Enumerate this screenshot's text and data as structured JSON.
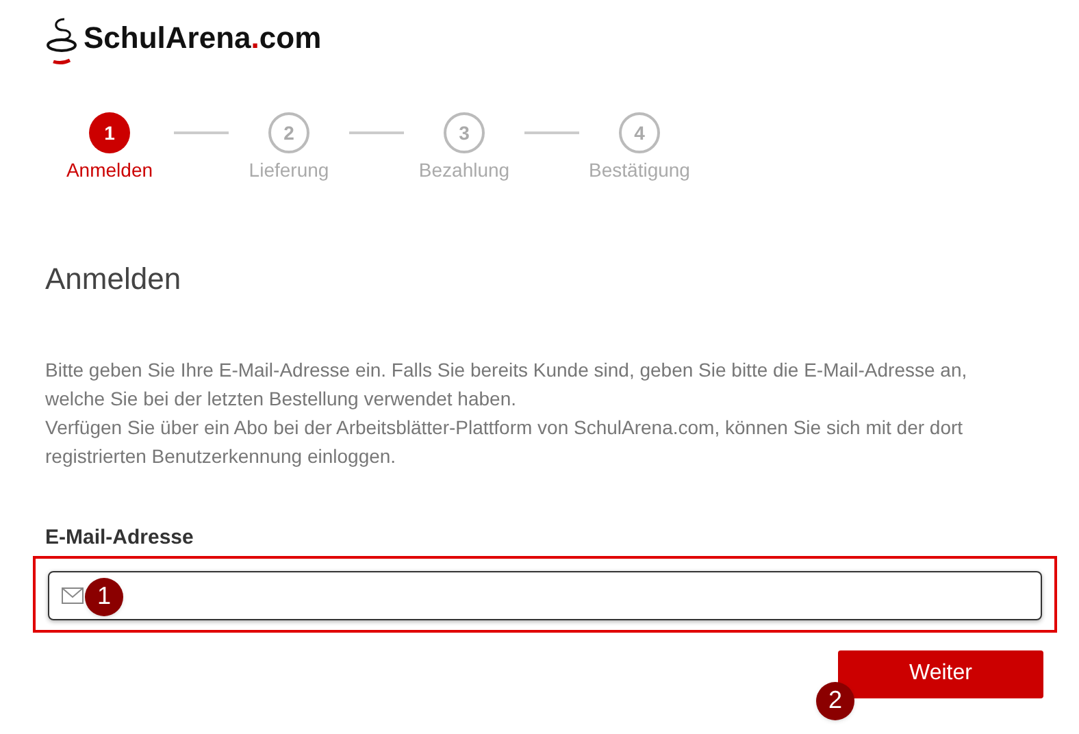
{
  "logo": {
    "name": "SchulArena",
    "dot": ".",
    "tld": "com"
  },
  "steps": [
    {
      "number": "1",
      "label": "Anmelden",
      "selected": true
    },
    {
      "number": "2",
      "label": "Lieferung",
      "selected": false
    },
    {
      "number": "3",
      "label": "Bezahlung",
      "selected": false
    },
    {
      "number": "4",
      "label": "Bestätigung",
      "selected": false
    }
  ],
  "heading": "Anmelden",
  "intro": [
    "Bitte geben Sie Ihre E-Mail-Adresse ein. Falls Sie bereits Kunde sind, geben Sie bitte die E-Mail-Adresse an, welche Sie bei der letzten Bestellung verwendet haben.",
    "Verfügen Sie über ein Abo bei der Arbeitsblätter-Plattform von SchulArena.com, können Sie sich mit der dort registrierten Benutzerkennung einloggen."
  ],
  "email": {
    "label": "E-Mail-Adresse",
    "highlighted": true
  },
  "annotations": [
    "1",
    "2"
  ],
  "button": "Weiter"
}
